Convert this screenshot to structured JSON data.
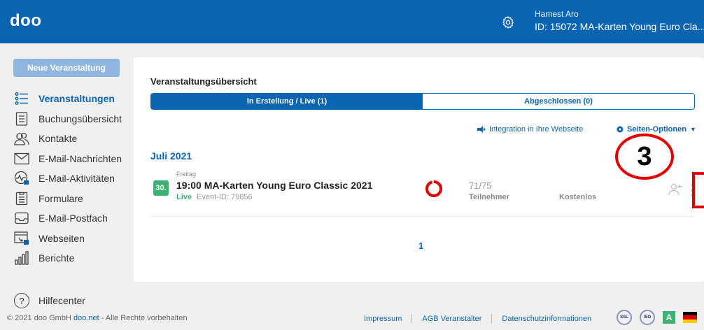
{
  "header": {
    "logo": "doo",
    "user_name": "Hamest Aro",
    "user_id_line": "ID: 15072  MA-Karten Young Euro Cla...",
    "accent": "#0a64b4"
  },
  "sidebar": {
    "new_button": "Neue Veranstaltung",
    "items": [
      {
        "label": "Veranstaltungen",
        "icon": "list-icon",
        "active": true
      },
      {
        "label": "Buchungsübersicht",
        "icon": "document-list-icon"
      },
      {
        "label": "Kontakte",
        "icon": "contacts-icon"
      },
      {
        "label": "E-Mail-Nachrichten",
        "icon": "envelope-icon"
      },
      {
        "label": "E-Mail-Aktivitäten",
        "icon": "activity-icon"
      },
      {
        "label": "Formulare",
        "icon": "form-icon"
      },
      {
        "label": "E-Mail-Postfach",
        "icon": "inbox-icon"
      },
      {
        "label": "Webseiten",
        "icon": "webpage-icon"
      },
      {
        "label": "Berichte",
        "icon": "bar-chart-icon"
      }
    ],
    "help": "Hilfecenter"
  },
  "main": {
    "title": "Veranstaltungsübersicht",
    "tabs": [
      {
        "label": "In Erstellung / Live (1)",
        "active": true
      },
      {
        "label": "Abgeschlossen (0)",
        "active": false
      }
    ],
    "integration_link": "Integration in Ihre Webseite",
    "settings_link": "Seiten-Optionen",
    "month": "Juli 2021",
    "event": {
      "weekday": "Freitag",
      "day": "30.",
      "title": "19:00 MA-Karten Young Euro Classic 2021",
      "status": "Live",
      "event_id": "Event-ID: 79856",
      "participants": "71/75",
      "participants_fraction": 0.9467,
      "participants_label": "Teilnehmer",
      "price": "Kostenlos"
    },
    "page": "1"
  },
  "annotation": {
    "number": "3",
    "color": "#e00000"
  },
  "footer": {
    "copyright_prefix": "© 2021 doo GmbH ",
    "copyright_brand": "doo.net",
    "copyright_suffix": " - Alle Rechte vorbehalten",
    "links": [
      "Impressum",
      "AGB Veranstalter",
      "Datenschutzinformationen"
    ],
    "badge_ssl": "SSL",
    "badge_iso": "ISO",
    "badge_a": "A"
  }
}
